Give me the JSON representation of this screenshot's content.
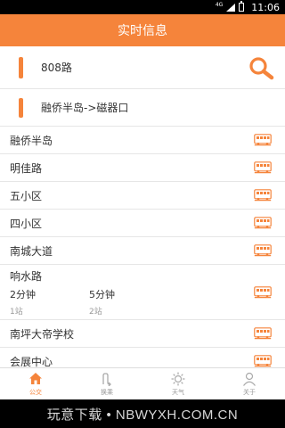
{
  "status_bar": {
    "network": "4G",
    "time": "11:06"
  },
  "header": {
    "title": "实时信息"
  },
  "search": {
    "route": "808路",
    "search_icon": "search-icon"
  },
  "direction": {
    "label": "融侨半岛->磁器口"
  },
  "stops": [
    {
      "name": "融侨半岛"
    },
    {
      "name": "明佳路"
    },
    {
      "name": "五小区"
    },
    {
      "name": "四小区"
    },
    {
      "name": "南城大道"
    },
    {
      "name": "响水路",
      "arrivals": [
        {
          "time": "2分钟",
          "stops": "1站"
        },
        {
          "time": "5分钟",
          "stops": "2站"
        }
      ]
    },
    {
      "name": "南坪大帝学校"
    },
    {
      "name": "会展中心"
    }
  ],
  "tabs": [
    {
      "label": "公交",
      "icon": "home-icon",
      "active": true
    },
    {
      "label": "换乘",
      "icon": "transfer-icon",
      "active": false
    },
    {
      "label": "天气",
      "icon": "sun-icon",
      "active": false
    },
    {
      "label": "关于",
      "icon": "person-icon",
      "active": false
    }
  ],
  "watermark": "玩意下载 • NBWYXH.COM.CN",
  "colors": {
    "accent": "#f5843b",
    "divider": "#e6e6e6",
    "text": "#333333",
    "muted": "#999999"
  }
}
